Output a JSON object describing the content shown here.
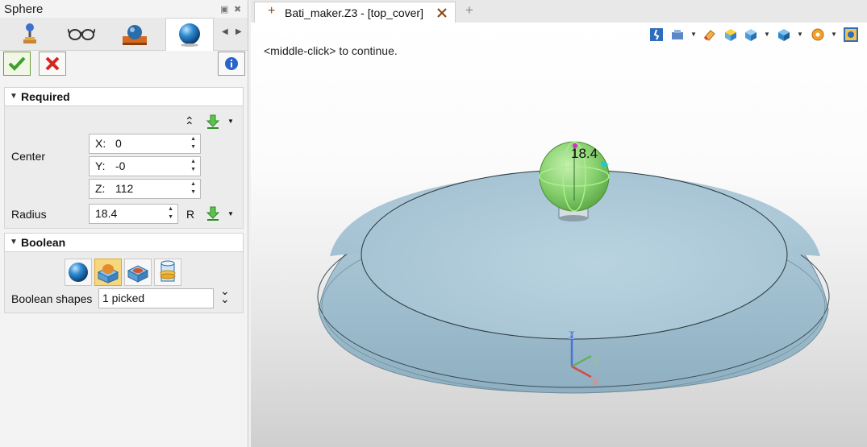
{
  "panel": {
    "title": "Sphere",
    "tabs": [
      "joystick-icon",
      "glasses-icon",
      "sphere-on-block-icon",
      "sphere-icon"
    ],
    "active_tab": 3
  },
  "actions": {
    "ok": "check-icon",
    "cancel": "x-icon",
    "info": "info-icon"
  },
  "required": {
    "title": "Required",
    "center_label": "Center",
    "x_axis": "X:",
    "x_value": "0",
    "y_axis": "Y:",
    "y_value": "-0",
    "z_axis": "Z:",
    "z_value": "112",
    "radius_label": "Radius",
    "radius_value": "18.4",
    "radius_suffix": "R"
  },
  "boolean": {
    "title": "Boolean",
    "shapes_label": "Boolean shapes",
    "shapes_value": "1 picked",
    "selected_option": 1
  },
  "document": {
    "tab_title": "Bati_maker.Z3 - [top_cover]",
    "new_tab_symbol": "+"
  },
  "viewport": {
    "hint": "<middle-click> to continue.",
    "dimension": "18.4",
    "axes": {
      "x": "X",
      "y": "Y",
      "z": "Z"
    }
  },
  "colors": {
    "accent_green": "#3aa12a",
    "cancel_red": "#d7261c",
    "selected_bool": "#f7d77e",
    "part_blue": "#a9c6d6",
    "sphere_green": "#8fd37a"
  }
}
